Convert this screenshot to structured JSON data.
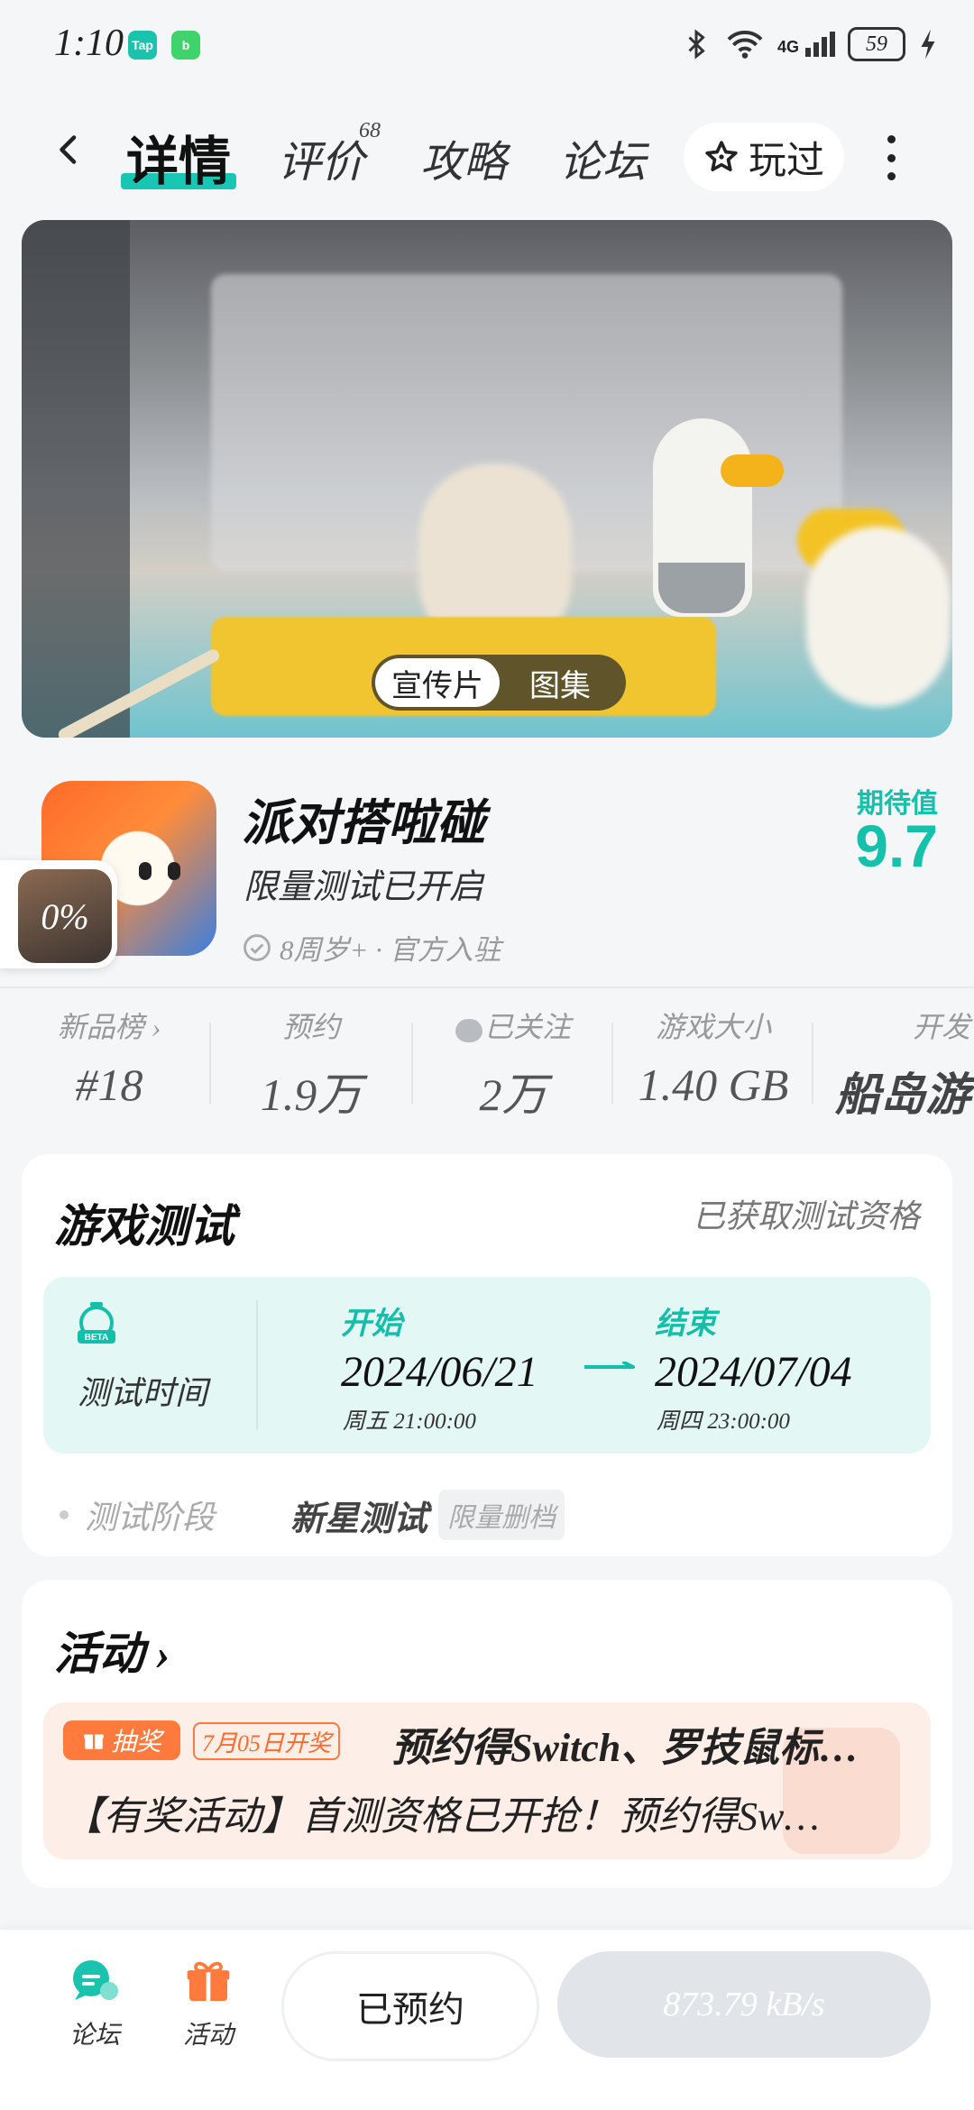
{
  "status_bar": {
    "time": "1:10",
    "app_badges": [
      {
        "label": "Tap",
        "color": "#19c3ad"
      },
      {
        "label": "b",
        "color": "#3fd36b"
      }
    ],
    "network": "4G",
    "battery": "59"
  },
  "nav": {
    "tabs": [
      {
        "label": "详情",
        "active": true
      },
      {
        "label": "评价",
        "badge": "68"
      },
      {
        "label": "攻略"
      },
      {
        "label": "论坛"
      }
    ],
    "played_label": "玩过"
  },
  "hero": {
    "media_options": [
      "宣传片",
      "图集"
    ],
    "selected": "宣传片"
  },
  "game": {
    "title": "派对搭啦碰",
    "subtitle": "限量测试已开启",
    "meta": "8周岁+ · 官方入驻",
    "expect_label": "期待值",
    "expect_value": "9.7",
    "progress_overlay": "0%"
  },
  "stats": [
    {
      "label": "新品榜",
      "value": "#18",
      "chevron": true
    },
    {
      "label": "预约",
      "value": "1.9万"
    },
    {
      "label": "已关注",
      "value": "2万",
      "icon": "heart-check-icon"
    },
    {
      "label": "游戏大小",
      "value": "1.40 GB"
    },
    {
      "label": "开发",
      "value": "船岛游"
    }
  ],
  "test_card": {
    "title": "游戏测试",
    "status": "已获取测试资格",
    "time_label": "测试时间",
    "start_head": "开始",
    "start_date": "2024/06/21",
    "start_time": "周五  21:00:00",
    "end_head": "结束",
    "end_date": "2024/07/04",
    "end_time": "周四  23:00:00",
    "stage_label": "测试阶段",
    "stage_value": "新星测试",
    "stage_tag": "限量删档",
    "beta_icon_text": "BETA"
  },
  "activity_card": {
    "title": "活动",
    "tag": "抽奖",
    "date_tag": "7月05日开奖",
    "headline": "预约得Switch、罗技鼠标…",
    "desc": "【有奖活动】首测资格已开抢！预约得Sw…"
  },
  "bottom_bar": {
    "forum_label": "论坛",
    "activity_label": "活动",
    "reserved_label": "已预约",
    "download_speed": "873.79 kB/s"
  },
  "colors": {
    "accent": "#18c7b3",
    "orange": "#ff7a3d"
  }
}
